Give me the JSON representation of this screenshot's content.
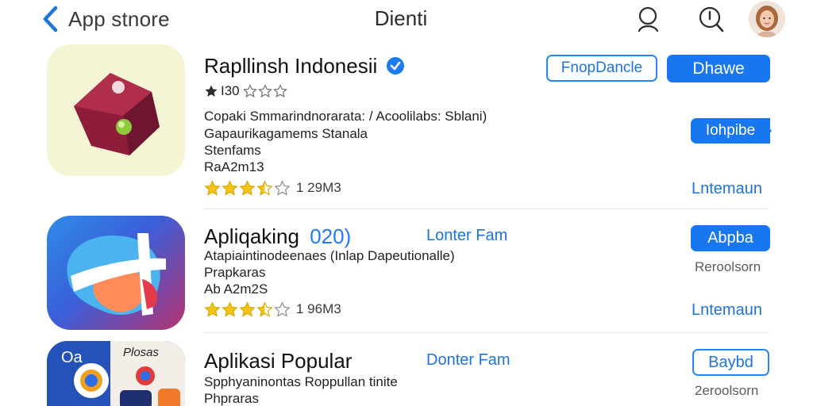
{
  "header": {
    "back_label": "App stnore",
    "title": "Dienti"
  },
  "apps": [
    {
      "name": "Rapllinsh Indonesii",
      "top_rating_text": "I30",
      "description": [
        "Copaki Smmarindnorarata: / Acoolilabs: Sblani)",
        "Gapaurikagamems Stanala",
        "Stenfams",
        "RaA2m13"
      ],
      "rating": 3.5,
      "rating_text": "1 29M3",
      "button_secondary": "FnopDancle",
      "button_primary": "Dhawe",
      "button_tag": "Iohpibe",
      "link_text": "Lntemaun"
    },
    {
      "name": "Apliqaking",
      "name_suffix": "020)",
      "developer": "Lonter Fam",
      "description": [
        "Atapiaintinodeenaes (Inlap Dapeutionalle)",
        "Prapkaras",
        "Ab A2m2S"
      ],
      "rating": 3.5,
      "rating_text": "1 96M3",
      "button_primary": "Abpba",
      "size_text": "Reroolsorn",
      "link_text": "Lntemaun"
    },
    {
      "name": "Aplikasi Popular",
      "developer": "Donter Fam",
      "icon_label_1": "Oa",
      "icon_label_2": "Plosas",
      "description": [
        "Spphyaninontas Roppullan tinite",
        "Phpraras"
      ],
      "button_outline": "Baybd",
      "size_text": "2eroolsorn"
    }
  ],
  "colors": {
    "accent": "#1877ee",
    "star": "#f5c518"
  }
}
